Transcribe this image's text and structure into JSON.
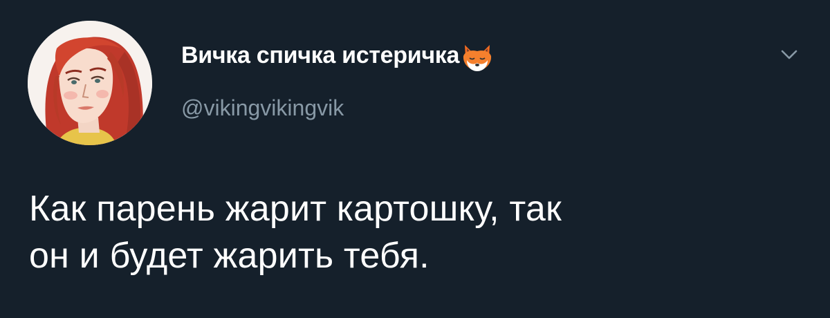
{
  "tweet": {
    "author": {
      "display_name": "Вичка спичка истеричка",
      "handle": "@vikingvikingvik",
      "name_emoji_icon": "fox-face-icon",
      "avatar_icon": "avatar-redhead-girl-illustration"
    },
    "menu_icon": "chevron-down-icon",
    "text_lines": [
      "Как парень жарит картошку, так",
      "он и будет жарить тебя."
    ]
  },
  "colors": {
    "background": "#15202b",
    "text_primary": "#ffffff",
    "text_secondary": "#8899a6"
  }
}
